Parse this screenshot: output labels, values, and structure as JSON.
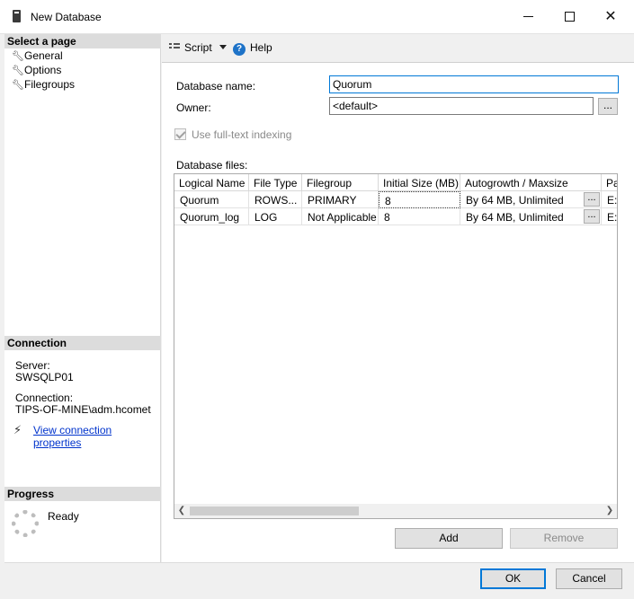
{
  "window": {
    "title": "New Database"
  },
  "left": {
    "select_page_header": "Select a page",
    "pages": [
      {
        "label": "General",
        "icon": "wrench-icon"
      },
      {
        "label": "Options",
        "icon": "wrench-icon"
      },
      {
        "label": "Filegroups",
        "icon": "wrench-icon"
      }
    ],
    "connection_header": "Connection",
    "server_label": "Server:",
    "server_value": "SWSQLP01",
    "connection_label": "Connection:",
    "connection_value": "TIPS-OF-MINE\\adm.hcomet",
    "view_properties_link": "View connection properties",
    "progress_header": "Progress",
    "progress_status": "Ready"
  },
  "toolbar": {
    "script_label": "Script",
    "help_label": "Help"
  },
  "form": {
    "db_name_label": "Database name:",
    "db_name_value": "Quorum",
    "owner_label": "Owner:",
    "owner_value": "<default>",
    "fulltext_label": "Use full-text indexing",
    "files_label": "Database files:",
    "browse": "..."
  },
  "grid": {
    "columns": [
      "Logical Name",
      "File Type",
      "Filegroup",
      "Initial Size (MB)",
      "Autogrowth / Maxsize",
      "Pa"
    ],
    "rows": [
      [
        "Quorum",
        "ROWS...",
        "PRIMARY",
        "8",
        "By 64 MB, Unlimited",
        "E:\\"
      ],
      [
        "Quorum_log",
        "LOG",
        "Not Applicable",
        "8",
        "By 64 MB, Unlimited",
        "E:\\"
      ]
    ],
    "cell_button": "..."
  },
  "buttons": {
    "add": "Add",
    "remove": "Remove",
    "ok": "OK",
    "cancel": "Cancel"
  },
  "colors": {
    "accent": "#0078d7",
    "link": "#0033cc"
  }
}
